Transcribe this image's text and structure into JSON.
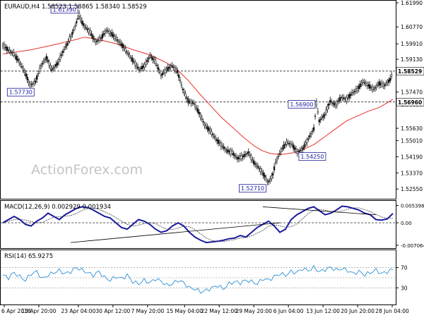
{
  "header": {
    "main": "EURAUD,H4  1.58523 1.58865 1.58340 1.58529",
    "macd": "MACD(12,26,9) 0.002929 0.001934",
    "rsi": "RSI(14) 65.9275"
  },
  "watermark": "ActionForex.com",
  "colors": {
    "price": "#111111",
    "ma": "#e8312a",
    "macd": "#1a1a9c",
    "rsi": "#2d8fd5",
    "label_border": "#1a1a9c",
    "label_text": "#1a1a9c"
  },
  "chart_data": [
    {
      "type": "line",
      "name": "main",
      "ylim": [
        1.522,
        1.6199
      ],
      "yticks": [
        "1.61990",
        "1.60770",
        "1.59910",
        "1.59130",
        "1.57470",
        "1.56850",
        "1.55630",
        "1.55010",
        "1.54190",
        "1.53370",
        "1.52550"
      ],
      "price_points": [
        [
          0,
          1.5985
        ],
        [
          2,
          1.596
        ],
        [
          4,
          1.594
        ],
        [
          6,
          1.59
        ],
        [
          8,
          1.585
        ],
        [
          10,
          1.578
        ],
        [
          12,
          1.58
        ],
        [
          14,
          1.588
        ],
        [
          16,
          1.592
        ],
        [
          18,
          1.586
        ],
        [
          20,
          1.589
        ],
        [
          22,
          1.595
        ],
        [
          24,
          1.6
        ],
        [
          25,
          1.603
        ],
        [
          26,
          1.606
        ],
        [
          27,
          1.61
        ],
        [
          28,
          1.6139
        ],
        [
          29,
          1.61
        ],
        [
          30,
          1.608
        ],
        [
          32,
          1.605
        ],
        [
          34,
          1.6
        ],
        [
          36,
          1.602
        ],
        [
          38,
          1.606
        ],
        [
          40,
          1.604
        ],
        [
          42,
          1.601
        ],
        [
          44,
          1.598
        ],
        [
          46,
          1.594
        ],
        [
          48,
          1.59
        ],
        [
          50,
          1.586
        ],
        [
          52,
          1.588
        ],
        [
          54,
          1.593
        ],
        [
          56,
          1.59
        ],
        [
          58,
          1.583
        ],
        [
          60,
          1.586
        ],
        [
          62,
          1.588
        ],
        [
          64,
          1.585
        ],
        [
          66,
          1.576
        ],
        [
          68,
          1.57
        ],
        [
          70,
          1.569
        ],
        [
          72,
          1.564
        ],
        [
          74,
          1.558
        ],
        [
          76,
          1.555
        ],
        [
          78,
          1.551
        ],
        [
          80,
          1.548
        ],
        [
          82,
          1.545
        ],
        [
          84,
          1.544
        ],
        [
          86,
          1.541
        ],
        [
          88,
          1.542
        ],
        [
          90,
          1.544
        ],
        [
          92,
          1.539
        ],
        [
          94,
          1.536
        ],
        [
          96,
          1.532
        ],
        [
          97,
          1.529
        ],
        [
          98,
          1.53
        ],
        [
          99,
          1.533
        ],
        [
          100,
          1.539
        ],
        [
          102,
          1.545
        ],
        [
          104,
          1.549
        ],
        [
          106,
          1.548
        ],
        [
          108,
          1.544
        ],
        [
          110,
          1.546
        ],
        [
          112,
          1.551
        ],
        [
          114,
          1.556
        ],
        [
          115,
          1.569
        ],
        [
          116,
          1.56
        ],
        [
          118,
          1.563
        ],
        [
          120,
          1.57
        ],
        [
          122,
          1.568
        ],
        [
          124,
          1.572
        ],
        [
          126,
          1.571
        ],
        [
          128,
          1.574
        ],
        [
          130,
          1.576
        ],
        [
          132,
          1.58
        ],
        [
          134,
          1.578
        ],
        [
          136,
          1.576
        ],
        [
          138,
          1.579
        ],
        [
          140,
          1.578
        ],
        [
          142,
          1.581
        ],
        [
          143,
          1.5853
        ]
      ],
      "ma_points": [
        [
          0,
          1.594
        ],
        [
          10,
          1.596
        ],
        [
          20,
          1.599
        ],
        [
          26,
          1.601
        ],
        [
          30,
          1.6025
        ],
        [
          36,
          1.601
        ],
        [
          42,
          1.599
        ],
        [
          48,
          1.596
        ],
        [
          54,
          1.5935
        ],
        [
          60,
          1.5895
        ],
        [
          64,
          1.586
        ],
        [
          68,
          1.5805
        ],
        [
          72,
          1.574
        ],
        [
          76,
          1.568
        ],
        [
          80,
          1.562
        ],
        [
          84,
          1.557
        ],
        [
          88,
          1.552
        ],
        [
          92,
          1.5475
        ],
        [
          95,
          1.545
        ],
        [
          98,
          1.5435
        ],
        [
          102,
          1.543
        ],
        [
          106,
          1.5438
        ],
        [
          110,
          1.5455
        ],
        [
          114,
          1.548
        ],
        [
          118,
          1.552
        ],
        [
          122,
          1.556
        ],
        [
          126,
          1.56
        ],
        [
          130,
          1.5625
        ],
        [
          134,
          1.565
        ],
        [
          138,
          1.5668
        ],
        [
          143,
          1.571
        ]
      ],
      "hlines": [
        1.5853,
        1.5696
      ],
      "annotations": [
        {
          "text": "1.61390",
          "i": 28,
          "y": 1.6139,
          "pos": "left"
        },
        {
          "text": "1.57730",
          "i": 12,
          "y": 1.5773,
          "pos": "left"
        },
        {
          "text": "1.52710",
          "i": 97,
          "y": 1.5271,
          "pos": "left"
        },
        {
          "text": "1.54250",
          "i": 108,
          "y": 1.5425,
          "pos": "right"
        },
        {
          "text": "1.56900",
          "i": 115,
          "y": 1.569,
          "pos": "left"
        }
      ],
      "price_tags": [
        {
          "text": "1.58529",
          "y": 1.5853
        },
        {
          "text": "1.56960",
          "y": 1.5696
        }
      ],
      "x_count": 144,
      "xticks": [
        {
          "label": "6 Apr 2018",
          "i": 0
        },
        {
          "label": "13 Apr 20:00",
          "i": 14
        },
        {
          "label": "23 Apr 04:00",
          "i": 30
        },
        {
          "label": "30 Apr 12:00",
          "i": 44
        },
        {
          "label": "7 May 20:00",
          "i": 58
        },
        {
          "label": "15 May 04:00",
          "i": 73
        },
        {
          "label": "22 May 12:00",
          "i": 87
        },
        {
          "label": "29 May 20:00",
          "i": 101
        },
        {
          "label": "6 Jun 04:00",
          "i": 115
        },
        {
          "label": "13 Jun 12:00",
          "i": 129
        },
        {
          "label": "20 Jun 20:00",
          "i": 143
        },
        {
          "label": "28 Jun 04:00",
          "i": 157
        }
      ]
    },
    {
      "type": "line",
      "name": "macd",
      "ylim": [
        -0.0075,
        0.0062
      ],
      "yticks": [
        "0.005398",
        "0.00",
        "-0.007064"
      ],
      "ytick_values": [
        0.005398,
        0.0,
        -0.007064
      ],
      "values": [
        0.0,
        0.001,
        0.002,
        0.001,
        -0.0005,
        -0.001,
        0.0005,
        0.0015,
        0.003,
        0.002,
        0.001,
        0.0025,
        0.0035,
        0.0045,
        0.005,
        0.0048,
        0.004,
        0.003,
        0.002,
        0.0015,
        0.0,
        -0.0015,
        -0.002,
        -0.0005,
        0.001,
        0.0005,
        -0.0005,
        -0.002,
        -0.003,
        -0.0025,
        -0.001,
        0.0,
        -0.001,
        -0.003,
        -0.0045,
        -0.0055,
        -0.0062,
        -0.006,
        -0.0058,
        -0.0055,
        -0.005,
        -0.0048,
        -0.004,
        -0.0045,
        -0.003,
        -0.0015,
        -0.0005,
        0.0005,
        -0.001,
        -0.003,
        -0.002,
        0.001,
        0.0025,
        0.0035,
        0.0045,
        0.005,
        0.0038,
        0.0025,
        0.003,
        0.004,
        0.0052,
        0.005,
        0.0045,
        0.004,
        0.003,
        0.0025,
        0.001,
        0.0008,
        0.0012,
        0.0029
      ],
      "trendlines": [
        [
          [
            12,
            -0.0062
          ],
          [
            49,
            0.0
          ]
        ],
        [
          [
            46,
            0.005
          ],
          [
            66,
            0.0025
          ]
        ]
      ]
    },
    {
      "type": "line",
      "name": "rsi",
      "ylim": [
        0,
        100
      ],
      "yticks": [
        "70",
        "30"
      ],
      "levels": [
        70,
        50,
        30
      ],
      "values": [
        55,
        50,
        60,
        52,
        45,
        58,
        62,
        48,
        55,
        60,
        64,
        58,
        62,
        70,
        65,
        60,
        55,
        62,
        50,
        45,
        52,
        48,
        55,
        42,
        38,
        45,
        40,
        48,
        43,
        35,
        38,
        45,
        40,
        30,
        28,
        22,
        25,
        30,
        35,
        28,
        38,
        42,
        40,
        45,
        42,
        38,
        48,
        45,
        52,
        58,
        55,
        62,
        60,
        68,
        64,
        70,
        62,
        66,
        70,
        65,
        68,
        64,
        58,
        62,
        56,
        60,
        65,
        58,
        62,
        66
      ]
    }
  ]
}
